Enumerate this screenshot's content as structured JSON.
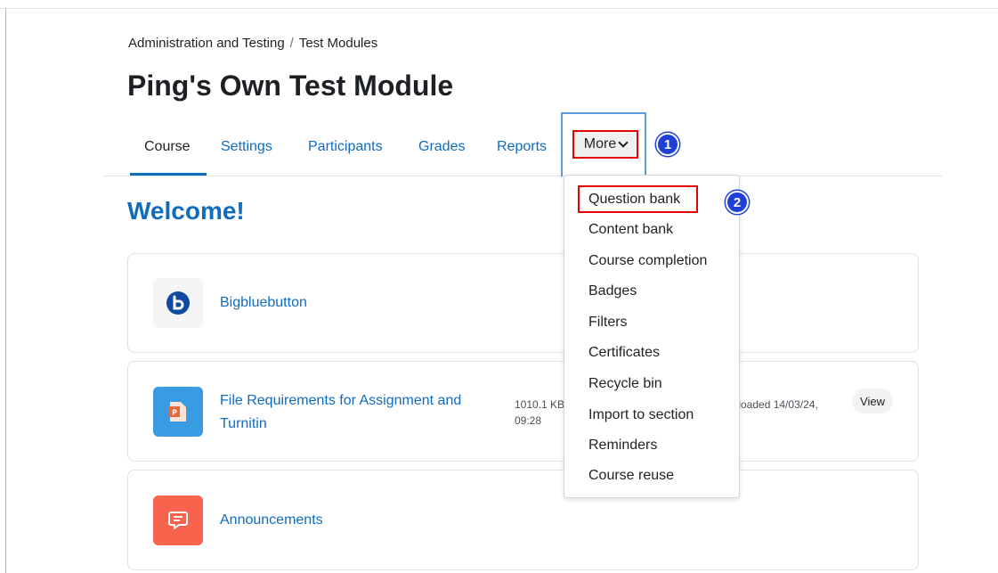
{
  "breadcrumb": {
    "items": [
      "Administration and Testing",
      "Test Modules"
    ],
    "separator": "/"
  },
  "page_title": "Ping's Own Test Module",
  "tabs": [
    {
      "label": "Course",
      "active": true
    },
    {
      "label": "Settings"
    },
    {
      "label": "Participants"
    },
    {
      "label": "Grades"
    },
    {
      "label": "Reports"
    }
  ],
  "more_label": "More",
  "annotations": {
    "step1": "1",
    "step2": "2"
  },
  "welcome": "Welcome!",
  "activities": [
    {
      "title": "Bigbluebutton",
      "icon": "bigbluebutton-icon"
    },
    {
      "title_line1": "File Requirements for Assignment and",
      "title_line2": "Turnitin",
      "size": "1010.1 KB",
      "time": "09:28",
      "uploaded": "Uploaded 14/03/24,",
      "view_label": "View",
      "icon": "powerpoint-file-icon"
    },
    {
      "title": "Announcements",
      "icon": "forum-icon"
    }
  ],
  "more_menu": [
    "Question bank",
    "Content bank",
    "Course completion",
    "Badges",
    "Filters",
    "Certificates",
    "Recycle bin",
    "Import to section",
    "Reminders",
    "Course reuse"
  ],
  "colors": {
    "accent": "#0f6cbf",
    "highlight_red": "#e60000",
    "badge_blue": "#1f3fd6",
    "file_icon_blue": "#399be2",
    "forum_icon_red": "#f7634d"
  }
}
